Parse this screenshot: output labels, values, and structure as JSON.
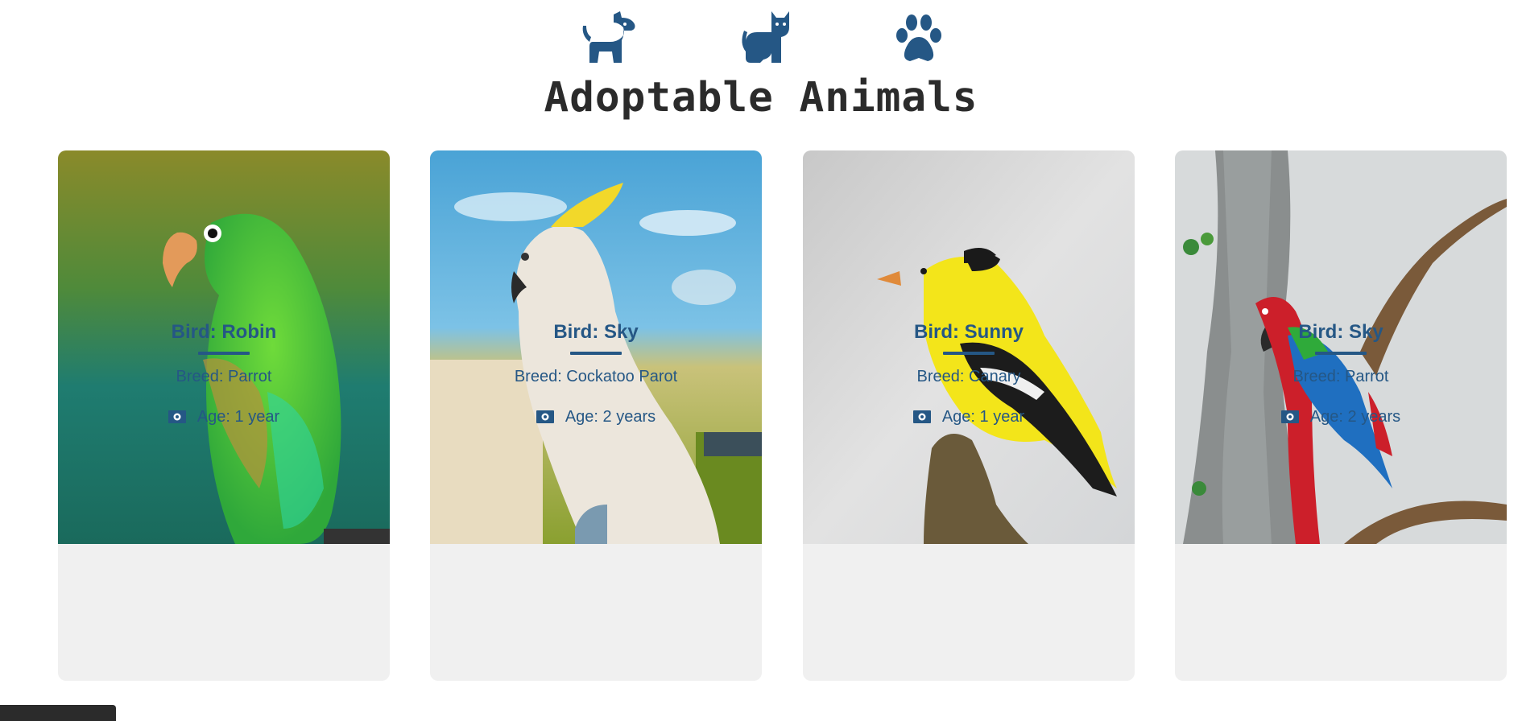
{
  "header": {
    "icons": [
      "dog-icon",
      "cat-icon",
      "paw-icon"
    ],
    "title": "Adoptable Animals"
  },
  "cards": [
    {
      "name": "Bird: Robin",
      "breed": "Breed: Parrot",
      "age": "Age: 1 year",
      "photo": "green-parrot-photo",
      "age_icon": "money-icon"
    },
    {
      "name": "Bird: Sky",
      "breed": "Breed: Cockatoo Parot",
      "age": "Age: 2 years",
      "photo": "white-cockatoo-photo",
      "age_icon": "money-icon"
    },
    {
      "name": "Bird: Sunny",
      "breed": "Breed: Canary",
      "age": "Age: 1 year",
      "photo": "yellow-canary-photo",
      "age_icon": "money-icon"
    },
    {
      "name": "Bird: Sky",
      "breed": "Breed: Parrot",
      "age": "Age: 2 years",
      "photo": "red-macaw-photo",
      "age_icon": "money-icon"
    }
  ],
  "colors": {
    "accent": "#255785",
    "card_bg": "#f0f0f0",
    "title": "#2b2b2b"
  }
}
